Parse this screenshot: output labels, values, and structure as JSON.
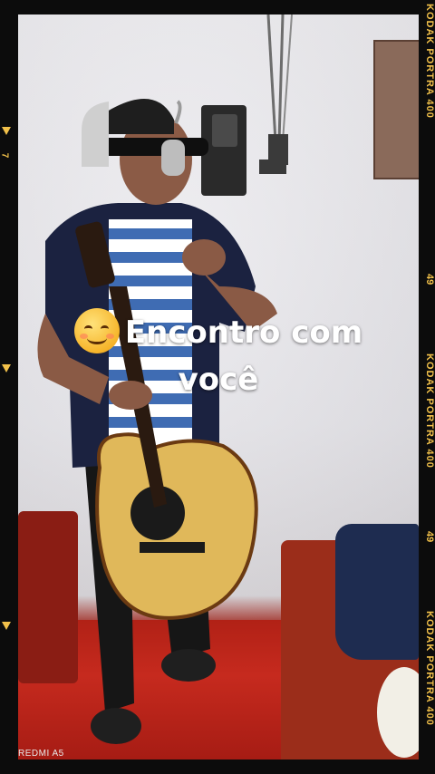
{
  "overlay": {
    "line1": "Encontro com",
    "line2": "você",
    "emoji_name": "smiling-face-icon"
  },
  "film_border": {
    "brand_top": "KODAK  PORTRA  400",
    "number_1": "49",
    "brand_mid": "KODAK  PORTRA  400",
    "number_2": "49",
    "brand_bottom": "KODAK  PORTRA  400",
    "left_number": "7",
    "accent_color": "#f2c14a"
  },
  "watermark": {
    "text": "REDMI A5"
  }
}
